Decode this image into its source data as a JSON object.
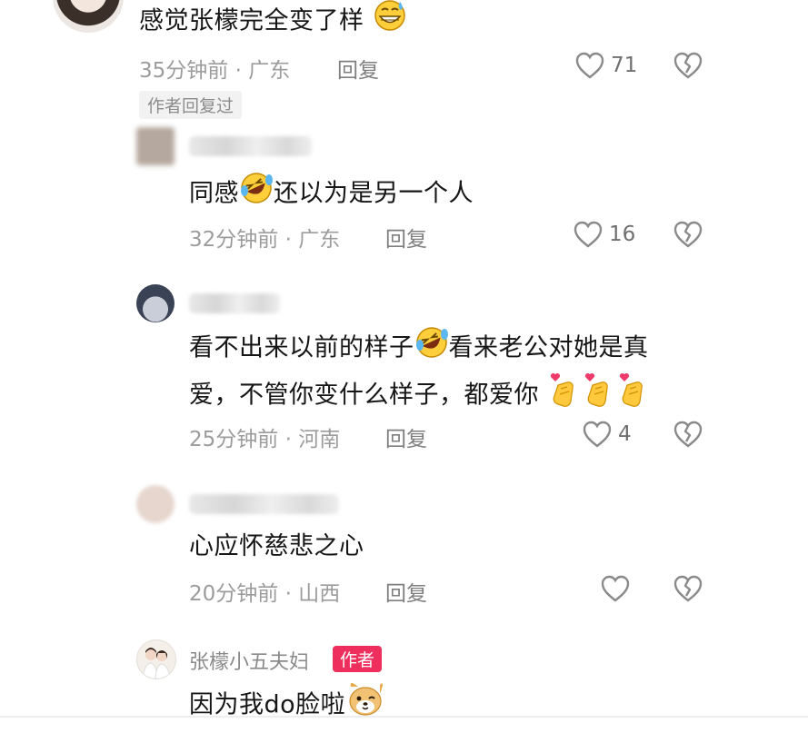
{
  "comments": [
    {
      "text": "感觉张檬完全变了样",
      "emoji": "sweat-grin-emoji",
      "time": "35分钟前",
      "location": "广东",
      "reply_label": "回复",
      "likes": "71",
      "author_replied_tag": "作者回复过"
    },
    {
      "text_before": "同感",
      "emoji": "rofl-emoji",
      "text_after": "还以为是另一个人",
      "time": "32分钟前",
      "location": "广东",
      "reply_label": "回复",
      "likes": "16"
    },
    {
      "line1_before": "看不出来以前的样子",
      "emoji": "rofl-emoji",
      "line1_after": "看来老公对她是真",
      "line2": "爱，不管你变什么样子，都爱你",
      "trailing_emojis": [
        "finger-heart-emoji",
        "finger-heart-emoji",
        "finger-heart-emoji"
      ],
      "time": "25分钟前",
      "location": "河南",
      "reply_label": "回复",
      "likes": "4"
    },
    {
      "text": "心应怀慈悲之心",
      "time": "20分钟前",
      "location": "山西",
      "reply_label": "回复",
      "likes": ""
    },
    {
      "username": "张檬小五夫妇",
      "author_badge": "作者",
      "text": "因为我do脸啦",
      "emoji": "dog-emoji"
    }
  ],
  "colors": {
    "author_badge": "#ee2e5c",
    "meta_text": "#9c9c9c",
    "icon_gray": "#8a8a8a"
  }
}
